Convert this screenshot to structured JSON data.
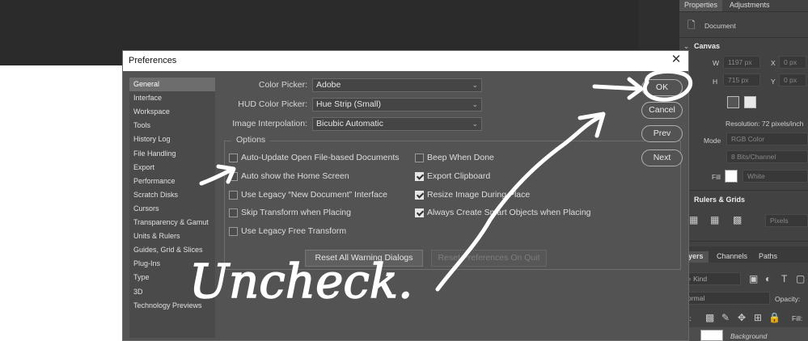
{
  "right_panel": {
    "tabs": [
      "Properties",
      "Adjustments"
    ],
    "document_label": "Document",
    "canvas_header": "Canvas",
    "w_label": "W",
    "w_value": "1197 px",
    "h_label": "H",
    "h_value": "715 px",
    "x_label": "X",
    "x_value": "0 px",
    "y_label": "Y",
    "y_value": "0 px",
    "resolution": "Resolution: 72 pixels/inch",
    "mode_label": "Mode",
    "mode_value": "RGB Color",
    "depth_value": "8 Bits/Channel",
    "fill_label": "Fill",
    "fill_value": "White",
    "rulers_header": "Rulers & Grids",
    "units_value": "Pixels",
    "layer_tabs": [
      "ayers",
      "Channels",
      "Paths"
    ],
    "kind_label": "Kind",
    "blend_value": "ormal",
    "opacity_label": "Opacity:",
    "lock_label": "ck:",
    "fill_short": "Fill:",
    "layer_name": "Background"
  },
  "dialog": {
    "title": "Preferences",
    "close_glyph": "✕",
    "sidebar": [
      "General",
      "Interface",
      "Workspace",
      "Tools",
      "History Log",
      "File Handling",
      "Export",
      "Performance",
      "Scratch Disks",
      "Cursors",
      "Transparency & Gamut",
      "Units & Rulers",
      "Guides, Grid & Slices",
      "Plug-Ins",
      "Type",
      "3D",
      "Technology Previews"
    ],
    "fields": {
      "color_picker_label": "Color Picker:",
      "color_picker_value": "Adobe",
      "hud_label": "HUD Color Picker:",
      "hud_value": "Hue Strip (Small)",
      "interp_label": "Image Interpolation:",
      "interp_value": "Bicubic Automatic",
      "arrow_glyph": "⌄"
    },
    "options_legend": "Options",
    "options_left": [
      {
        "label": "Auto-Update Open File-based Documents",
        "checked": false
      },
      {
        "label": "Auto show the Home Screen",
        "checked": false
      },
      {
        "label": "Use Legacy “New Document” Interface",
        "checked": false
      },
      {
        "label": "Skip Transform when Placing",
        "checked": false
      },
      {
        "label": "Use Legacy Free Transform",
        "checked": false
      }
    ],
    "options_right": [
      {
        "label": "Beep When Done",
        "checked": false
      },
      {
        "label": "Export Clipboard",
        "checked": true
      },
      {
        "label": "Resize Image During Place",
        "checked": true
      },
      {
        "label": "Always Create Smart Objects when Placing",
        "checked": true
      }
    ],
    "reset_warnings": "Reset All Warning Dialogs",
    "reset_prefs": "Reset Preferences On Quit",
    "buttons": {
      "ok": "OK",
      "cancel": "Cancel",
      "prev": "Prev",
      "next": "Next"
    }
  },
  "annotation": {
    "text": "Uncheck.",
    "color": "#ffffff"
  },
  "colors": {
    "dialog_bg": "#535353",
    "sidebar_bg": "#4a4a4a",
    "selected_item": "#6d6d6d",
    "panel_bg": "#424242"
  }
}
